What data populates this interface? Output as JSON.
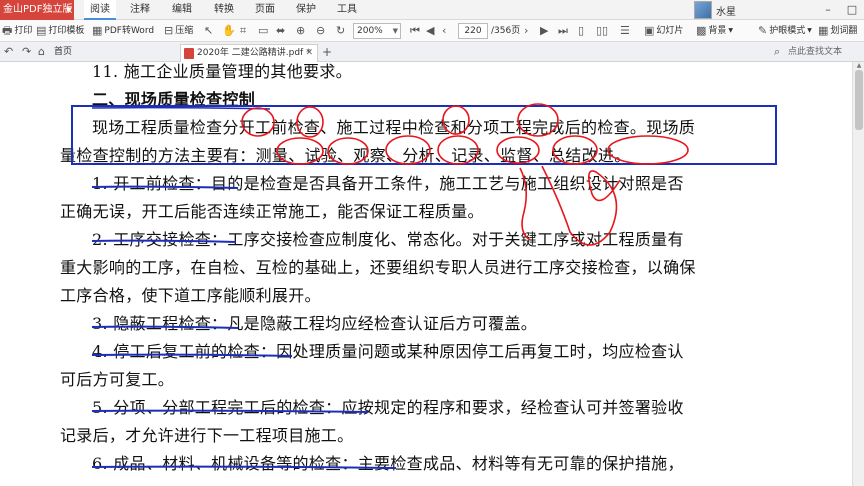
{
  "app": {
    "brand": "金山PDF独立版",
    "menu": [
      "阅读",
      "注释",
      "编辑",
      "转换",
      "页面",
      "保护",
      "工具"
    ],
    "active_menu": "阅读",
    "user": "水星"
  },
  "toolbar": {
    "print": "打印",
    "print_template": "打印模板",
    "pdf_to_word": "PDF转Word",
    "compress": "压缩",
    "zoom": "200%",
    "page_current": "220",
    "page_total": "/356页",
    "slideshow": "幻灯片",
    "background": "背景",
    "eye_care": "护眼模式",
    "highlight": "划词翻"
  },
  "tabs": {
    "home": "首页",
    "doc": "2020年 二建公路精讲.pdf *",
    "find_placeholder": "点此查找文本"
  },
  "document": {
    "lines": [
      "11.  施工企业质量管理的其他要求。",
      "二、现场质量检查控制",
      "现场工程质量检查分开工前检查、施工过程中检查和分项工程完成后的检查。现场质",
      "量检查控制的方法主要有：测量、试验、观察、分析、记录、监督、总结改进。",
      "1.  开工前检查：目的是检查是否具备开工条件，施工工艺与施工组织设计对照是否",
      "正确无误，开工后能否连续正常施工，能否保证工程质量。",
      "2.  工序交接检查：工序交接检查应制度化、常态化。对于关键工序或对工程质量有",
      "重大影响的工序，在自检、互检的基础上，还要组织专职人员进行工序交接检查，以确保",
      "工序合格，使下道工序能顺利展开。",
      "3.  隐蔽工程检查：凡是隐蔽工程均应经检查认证后方可覆盖。",
      "4.  停工后复工前的检查：因处理质量问题或某种原因停工后再复工时，均应检查认",
      "可后方可复工。",
      "5.  分项、分部工程完工后的检查：应按规定的程序和要求，经检查认可并签署验收",
      "记录后，才允许进行下一工程项目施工。",
      "6.  成品、材料、机械设备等的检查：主要检查成品、材料等有无可靠的保护措施，"
    ]
  },
  "colors": {
    "brand_red": "#d6453c",
    "annotation_red": "#e8161c",
    "annotation_blue": "#1d2fb8"
  }
}
